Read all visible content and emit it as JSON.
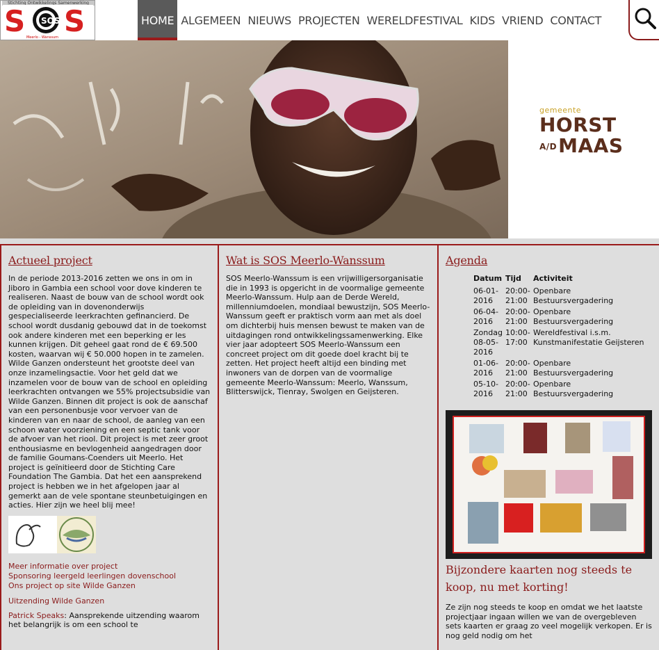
{
  "header": {
    "logo": {
      "tagline": "Stichting Ontwikkelings Samenwerking",
      "letters": "SOS",
      "subline": "Meerlo - Wanssum"
    },
    "nav": [
      {
        "label": "HOME",
        "active": true
      },
      {
        "label": "ALGEMEEN",
        "active": false
      },
      {
        "label": "NIEUWS",
        "active": false
      },
      {
        "label": "PROJECTEN",
        "active": false
      },
      {
        "label": "WERELDFESTIVAL",
        "active": false
      },
      {
        "label": "KIDS",
        "active": false
      },
      {
        "label": "VRIEND",
        "active": false
      },
      {
        "label": "CONTACT",
        "active": false
      }
    ],
    "search_icon": "search-icon"
  },
  "hero": {
    "sponsor": {
      "small": "gemeente",
      "line1": "HORST",
      "ad": "A/D",
      "line2": "MAAS"
    }
  },
  "col1": {
    "title": "Actueel project",
    "body": "In de periode 2013-2016 zetten we ons in om in Jiboro in Gambia een school voor dove kinderen te realiseren. Naast de bouw van de school wordt ook de opleiding van in dovenonderwijs gespecialiseerde leerkrachten gefinancierd. De school wordt dusdanig gebouwd dat in de toekomst ook andere kinderen met een beperking er les kunnen krijgen. Dit geheel gaat rond de € 69.500 kosten, waarvan wij € 50.000 hopen in te zamelen. Wilde Ganzen ondersteunt het grootste deel van onze inzamelingsactie. Voor het geld dat we inzamelen voor de bouw van de school en opleiding leerkrachten ontvangen we 55% projectsubsidie van Wilde Ganzen. Binnen dit project is ook de aanschaf van een personenbusje voor vervoer van de kinderen van en naar de school, de aanleg van een schoon water voorziening en een septic tank voor de afvoer van het riool. Dit project is met zeer groot enthousiasme en bevlogenheid aangedragen door de familie Goumans-Coenders uit Meerlo. Het project is geïnitieerd door de Stichting Care Foundation The Gambia. Dat het een aansprekend project is hebben we in het afgelopen jaar al gemerkt aan de vele spontane steunbetuigingen en acties. Hier zijn we heel blij mee!",
    "links": [
      "Meer informatie over project",
      "Sponsoring leergeld leerlingen dovenschool",
      "Ons project op site Wilde Ganzen"
    ],
    "link_broadcast": "Uitzending Wilde Ganzen",
    "speaks_link": "Patrick Speaks",
    "speaks_text": ": Aansprekende uitzending waarom het belangrijk is om een school te"
  },
  "col2": {
    "title": "Wat is SOS Meerlo-Wanssum",
    "body": "SOS Meerlo-Wanssum is een vrijwilligersorganisatie die in 1993 is opgericht in de voormalige gemeente Meerlo-Wanssum. Hulp aan de Derde Wereld, millenniumdoelen, mondiaal bewustzijn, SOS Meerlo-Wanssum geeft er praktisch vorm aan met als doel om dichterbij huis mensen bewust te maken van de uitdagingen rond ontwikkelingssamenwerking. Elke vier jaar adopteert SOS Meerlo-Wanssum een concreet project om dit goede doel kracht bij te zetten. Het project heeft altijd een binding met inwoners van de dorpen van de voormalige gemeente Meerlo-Wanssum: Meerlo, Wanssum, Blitterswijck, Tienray, Swolgen en Geijsteren."
  },
  "col3": {
    "title": "Agenda",
    "headers": [
      "Datum",
      "Tijd",
      "Activiteit"
    ],
    "rows": [
      {
        "date": "06-01-2016",
        "time": "20:00-21:00",
        "activity": "Openbare Bestuursvergadering"
      },
      {
        "date": "06-04-2016",
        "time": "20:00-21:00",
        "activity": "Openbare Bestuursvergadering"
      },
      {
        "date": "Zondag 08-05-2016",
        "time": "10:00-17:00",
        "activity": "Wereldfestival i.s.m. Kunstmanifestatie Geijsteren"
      },
      {
        "date": "01-06-2016",
        "time": "20:00-21:00",
        "activity": "Openbare Bestuursvergadering"
      },
      {
        "date": "05-10-2016",
        "time": "20:00-21:00",
        "activity": "Openbare Bestuursvergadering"
      }
    ],
    "cards_title": "Bijzondere kaarten nog steeds te koop, nu met korting!",
    "cards_text": "Ze zijn nog steeds te koop en omdat we het laatste projectjaar ingaan willen we van de overgebleven sets kaarten er graag zo veel mogelijk verkopen. Er is nog geld nodig om het"
  },
  "colors": {
    "accent": "#8a1b1b",
    "column_bg": "#dedede",
    "nav_active_bg": "#5a5a5a"
  }
}
